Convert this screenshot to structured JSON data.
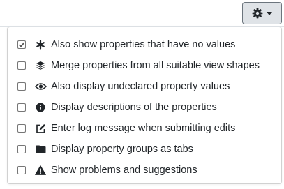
{
  "toolbar": {
    "settings_button": {
      "icon": "gear-icon",
      "caret_icon": "caret-down-icon"
    }
  },
  "menu": {
    "items": [
      {
        "label": "Also show properties that have no values",
        "checked": true,
        "icon": "asterisk-icon"
      },
      {
        "label": "Merge properties from all suitable view shapes",
        "checked": false,
        "icon": "layers-icon"
      },
      {
        "label": "Also display undeclared property values",
        "checked": false,
        "icon": "eye-icon"
      },
      {
        "label": "Display descriptions of the properties",
        "checked": false,
        "icon": "info-circle-icon"
      },
      {
        "label": "Enter log message when submitting edits",
        "checked": false,
        "icon": "edit-icon"
      },
      {
        "label": "Display property groups as tabs",
        "checked": false,
        "icon": "folder-icon"
      },
      {
        "label": "Show problems and suggestions",
        "checked": false,
        "icon": "warning-icon"
      }
    ]
  },
  "colors": {
    "button_bg": "#dfe3e7",
    "button_border": "#6c757d",
    "text": "#212529",
    "divider": "#dee2e6"
  }
}
